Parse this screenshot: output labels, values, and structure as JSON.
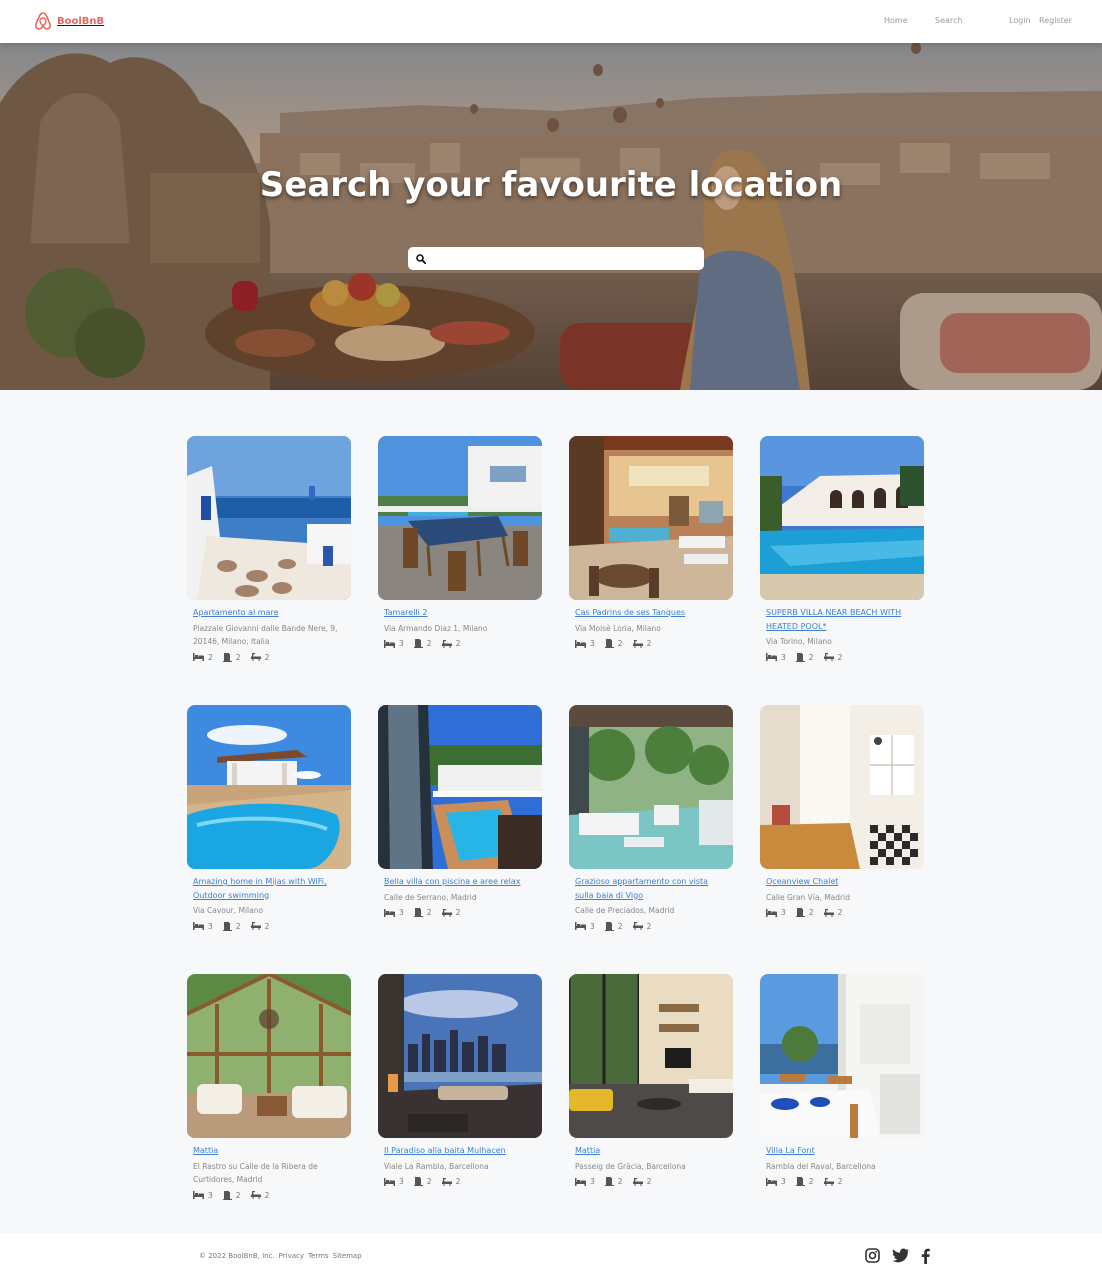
{
  "header": {
    "brand": "BoolBnB",
    "nav": {
      "home": "Home",
      "search": "Search"
    },
    "auth": {
      "login": "Login",
      "register": "Register"
    },
    "brand_color": "#e9685e"
  },
  "hero": {
    "title": "Search your favourite location",
    "search_placeholder": "",
    "search_value": ""
  },
  "listings": [
    {
      "title": "Apartamento al mare",
      "address": "Piazzale Giovanni dalle Bande Nere, 9, 20146, Milano, Italia",
      "rooms": "2",
      "beds": "2",
      "bathrooms": "2"
    },
    {
      "title": "Tamarelli 2",
      "address": "Via Armando Diaz 1, Milano",
      "rooms": "3",
      "beds": "2",
      "bathrooms": "2"
    },
    {
      "title": "Cas Padrins de ses Tanques",
      "address": "Via Moisè Loria, Milano",
      "rooms": "3",
      "beds": "2",
      "bathrooms": "2"
    },
    {
      "title": "SUPERB VILLA NEAR BEACH WITH HEATED POOL*",
      "address": "Via Torino, Milano",
      "rooms": "3",
      "beds": "2",
      "bathrooms": "2"
    },
    {
      "title": "Amazing home in Mijas with WiFi, Outdoor swimming",
      "address": "Via Cavour, Milano",
      "rooms": "3",
      "beds": "2",
      "bathrooms": "2"
    },
    {
      "title": "Bella villa con piscina e aree relax",
      "address": "Calle de Serrano, Madrid",
      "rooms": "3",
      "beds": "2",
      "bathrooms": "2"
    },
    {
      "title": "Grazioso appartamento con vista sulla baia di Vigo",
      "address": "Calle de Preciados, Madrid",
      "rooms": "3",
      "beds": "2",
      "bathrooms": "2"
    },
    {
      "title": "Oceanview Chalet",
      "address": "Calle Gran Vía, Madrid",
      "rooms": "3",
      "beds": "2",
      "bathrooms": "2"
    },
    {
      "title": "Mattia",
      "address": "El Rastro su Calle de la Ribera de Curtidores, Madrid",
      "rooms": "3",
      "beds": "2",
      "bathrooms": "2"
    },
    {
      "title": "Il Paradiso alla baita Mulhacen",
      "address": "Viale La Rambla, Barcellona",
      "rooms": "3",
      "beds": "2",
      "bathrooms": "2"
    },
    {
      "title": "Mattia",
      "address": "Passeig de Gràcia, Barcellona",
      "rooms": "3",
      "beds": "2",
      "bathrooms": "2"
    },
    {
      "title": "Villa La Font",
      "address": "Rambla del Raval, Barcellona",
      "rooms": "3",
      "beds": "2",
      "bathrooms": "2"
    }
  ],
  "footer": {
    "copyright": "© 2022 BoolBnB, Inc.",
    "links": {
      "privacy": "Privacy",
      "terms": "Terms",
      "sitemap": "Sitemap"
    },
    "social_icons": [
      "instagram-icon",
      "twitter-icon",
      "facebook-icon"
    ]
  }
}
